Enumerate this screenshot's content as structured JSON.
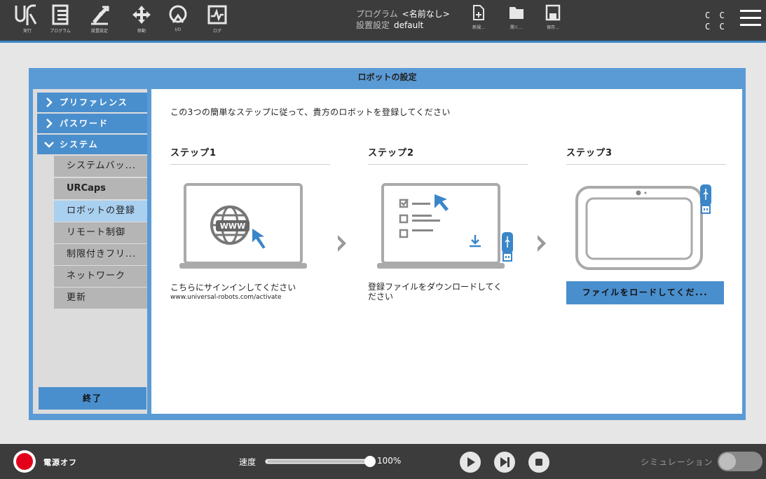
{
  "topbar": {
    "nav": [
      {
        "id": "run",
        "label": "実行",
        "icon": "ur-logo-icon"
      },
      {
        "id": "program",
        "label": "プログラム",
        "icon": "program-icon"
      },
      {
        "id": "installation",
        "label": "設置設定",
        "icon": "robot-arm-icon"
      },
      {
        "id": "move",
        "label": "移動",
        "icon": "move-icon"
      },
      {
        "id": "io",
        "label": "I/O",
        "icon": "io-icon"
      },
      {
        "id": "log",
        "label": "ログ",
        "icon": "log-icon"
      }
    ],
    "program_label": "プログラム",
    "program_value": "<名前なし>",
    "installation_label": "設置設定",
    "installation_value": "default",
    "file_buttons": [
      {
        "id": "new",
        "label": "新規...",
        "icon": "new-file-icon"
      },
      {
        "id": "open",
        "label": "開く...",
        "icon": "folder-icon"
      },
      {
        "id": "save",
        "label": "保存...",
        "icon": "save-icon"
      }
    ],
    "cc_line1": "C C",
    "cc_line2": "C C",
    "accent_color": "#3a86c8"
  },
  "dialog": {
    "title": "ロボットの設定",
    "sidebar": {
      "top_items": [
        {
          "label": "プリファレンス",
          "expanded": false
        },
        {
          "label": "パスワード",
          "expanded": false
        },
        {
          "label": "システム",
          "expanded": true
        }
      ],
      "sub_items": [
        {
          "label": "システムバッ...",
          "active": false
        },
        {
          "label": "URCaps",
          "active": false
        },
        {
          "label": "ロボットの登録",
          "active": true
        },
        {
          "label": "リモート制御",
          "active": false
        },
        {
          "label": "制限付きフリ...",
          "active": false
        },
        {
          "label": "ネットワーク",
          "active": false
        },
        {
          "label": "更新",
          "active": false
        }
      ],
      "finish_label": "終了"
    },
    "content": {
      "intro": "この3つの簡単なステップに従って、貴方のロボットを登録してください",
      "steps": [
        {
          "title": "ステップ1",
          "desc": "こちらにサインインしてください",
          "url": "www.universal-robots.com/activate"
        },
        {
          "title": "ステップ2",
          "desc_line1": "登録ファイルをダウンロードしてく",
          "desc_line2": "ださい"
        },
        {
          "title": "ステップ3",
          "button": "ファイルをロードしてくだ..."
        }
      ],
      "www_text": "WWW"
    }
  },
  "bottombar": {
    "power_label": "電源オフ",
    "speed_label": "速度",
    "speed_value": "100%",
    "speed_fraction": 1.0,
    "simulation_label": "シミュレーション",
    "simulation_on": false
  }
}
